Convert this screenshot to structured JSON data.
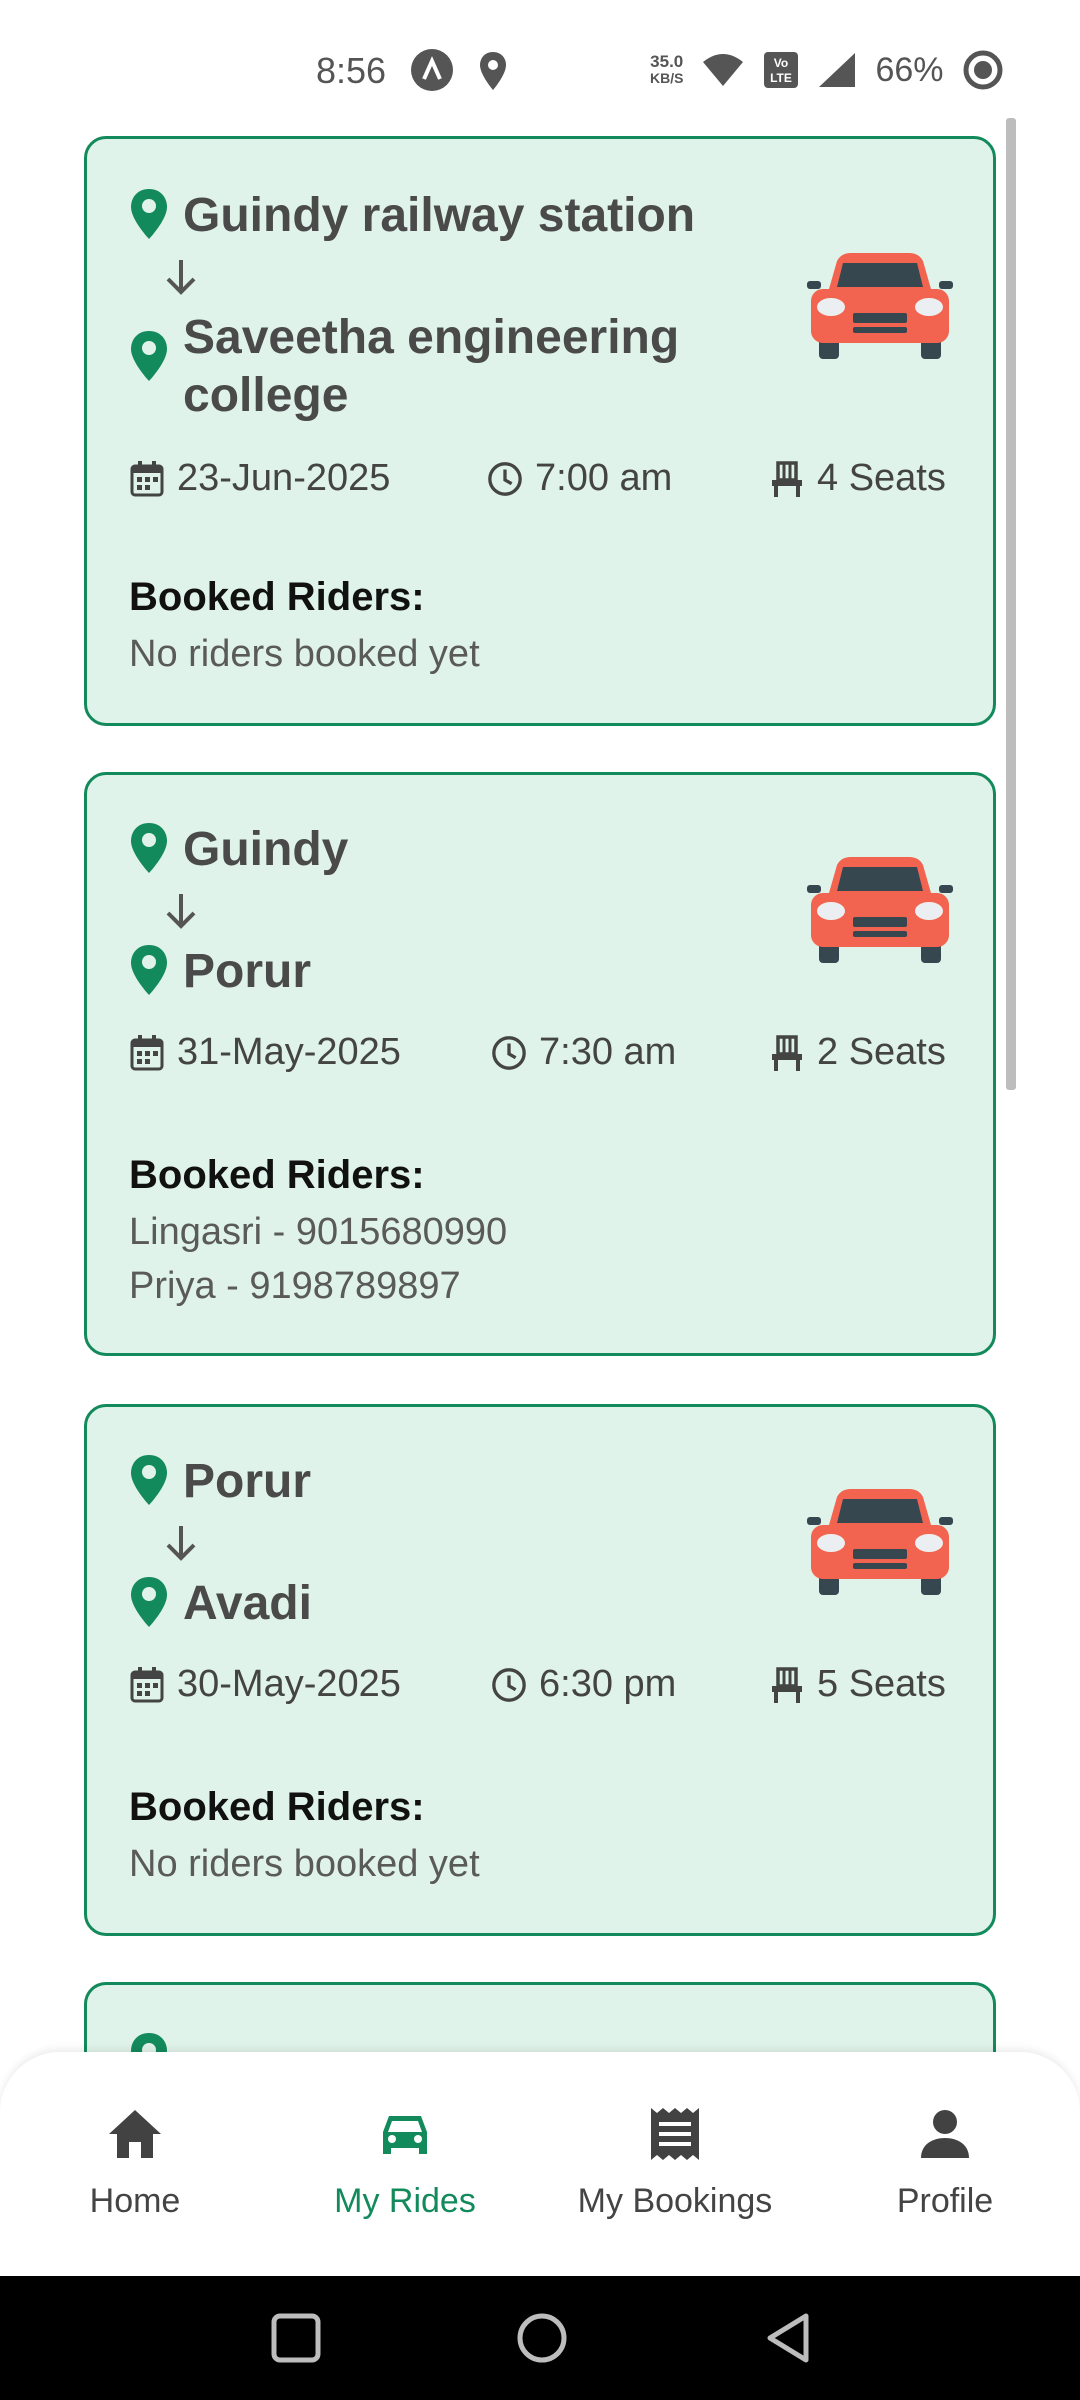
{
  "status_bar": {
    "time": "8:56",
    "net_speed_value": "35.0",
    "net_speed_unit": "KB/S",
    "battery": "66%"
  },
  "colors": {
    "accent": "#138a5b",
    "card_bg": "#dff3ea",
    "car": "#f26450"
  },
  "rides": [
    {
      "from": "Guindy railway station",
      "to": "Saveetha engineering college",
      "date": "23-Jun-2025",
      "time": "7:00 am",
      "seats": "4 Seats",
      "riders_title": "Booked Riders:",
      "riders": [
        "No riders booked yet"
      ]
    },
    {
      "from": "Guindy",
      "to": "Porur",
      "date": "31-May-2025",
      "time": "7:30 am",
      "seats": "2 Seats",
      "riders_title": "Booked Riders:",
      "riders": [
        "Lingasri - 9015680990",
        "Priya - 9198789897"
      ]
    },
    {
      "from": "Porur",
      "to": "Avadi",
      "date": "30-May-2025",
      "time": "6:30 pm",
      "seats": "5 Seats",
      "riders_title": "Booked Riders:",
      "riders": [
        "No riders booked yet"
      ]
    }
  ],
  "bottom_nav": {
    "items": [
      {
        "label": "Home",
        "icon": "home-icon"
      },
      {
        "label": "My Rides",
        "icon": "car-icon"
      },
      {
        "label": "My Bookings",
        "icon": "receipt-icon"
      },
      {
        "label": "Profile",
        "icon": "person-icon"
      }
    ],
    "active_index": 1
  }
}
